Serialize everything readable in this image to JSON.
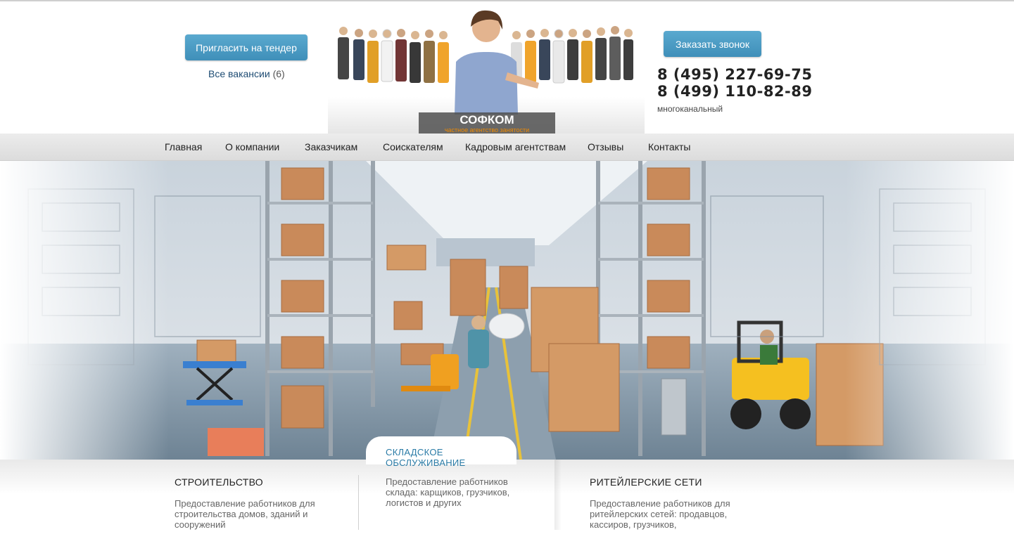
{
  "header": {
    "tender_button": "Пригласить на тендер",
    "vacancies_label": "Все вакансии",
    "vacancies_count": "(6)",
    "call_button": "Заказать звонок",
    "phone_1": "8 (495) 227-69-75",
    "phone_2": "8 (499) 110-82-89",
    "phone_note": "многоканальный",
    "brand_name": "СОФКОМ",
    "brand_tagline": "частное агентство занятости"
  },
  "nav": {
    "items": [
      "Главная",
      "О компании",
      "Заказчикам",
      "Соискателям",
      "Кадровым агентствам",
      "Отзывы",
      "Контакты"
    ]
  },
  "services": {
    "construction": {
      "title": "СТРОИТЕЛЬСТВО",
      "text_1": "Предоставление работников для",
      "text_2": "строительства домов, зданий и",
      "text_3": "сооружений"
    },
    "warehouse": {
      "title_1": "СКЛАДСКОЕ",
      "title_2": "ОБСЛУЖИВАНИЕ",
      "text_1": "Предоставление работников",
      "text_2": "склада: карщиков, грузчиков,",
      "text_3": "логистов и других"
    },
    "retail": {
      "title": "РИТЕЙЛЕРСКИЕ СЕТИ",
      "text_1": "Предоставление работников для",
      "text_2": "ритейлерских сетей: продавцов,",
      "text_3": "кассиров, грузчиков,"
    }
  },
  "colors": {
    "accent": "#4a9cc6",
    "link": "#1e4c73",
    "brand_orange": "#f08a00"
  }
}
